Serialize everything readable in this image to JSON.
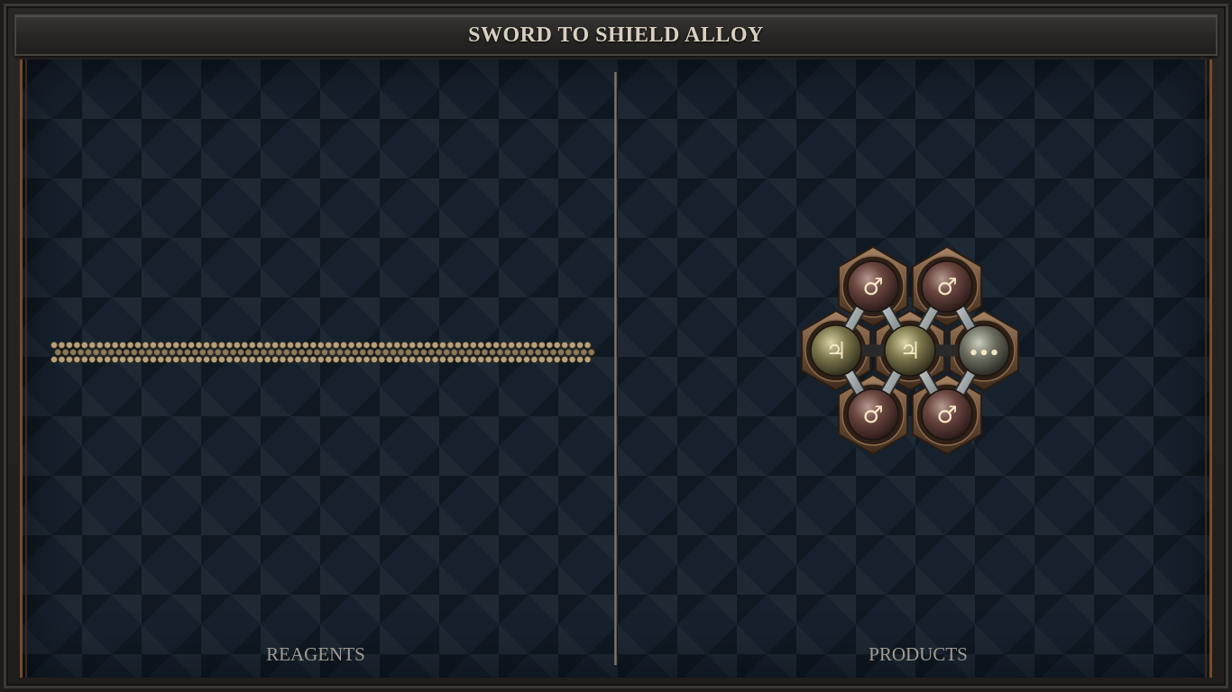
{
  "title": "SWORD TO SHIELD ALLOY",
  "panels": {
    "reagents_label": "REAGENTS",
    "products_label": "PRODUCTS"
  },
  "colors": {
    "board": "#16212d",
    "frame": "#2a2826",
    "title_text": "#d9cfc0",
    "label_text": "#a29b92",
    "copper_trim": "#7a4a2a",
    "atom_iron": "#5d3a36",
    "atom_tin": "#6c6843",
    "atom_salt": "#575a4d",
    "glyph": "#f3e6c4"
  },
  "reagent": {
    "description_icon": "long-atom-chain",
    "rows": 3,
    "atoms_per_row": 71
  },
  "product_molecule": {
    "atoms": [
      {
        "id": "a1",
        "element": "iron",
        "symbol": "♂"
      },
      {
        "id": "a2",
        "element": "iron",
        "symbol": "♂"
      },
      {
        "id": "a3",
        "element": "tin",
        "symbol": "♃"
      },
      {
        "id": "a4",
        "element": "tin",
        "symbol": "♃"
      },
      {
        "id": "a5",
        "element": "salt",
        "symbol": "•••"
      },
      {
        "id": "a6",
        "element": "iron",
        "symbol": "♂"
      },
      {
        "id": "a7",
        "element": "iron",
        "symbol": "♂"
      }
    ],
    "bonds": [
      [
        "a1",
        "a3"
      ],
      [
        "a1",
        "a4"
      ],
      [
        "a2",
        "a4"
      ],
      [
        "a2",
        "a5"
      ],
      [
        "a3",
        "a4"
      ],
      [
        "a4",
        "a5"
      ],
      [
        "a3",
        "a6"
      ],
      [
        "a4",
        "a6"
      ],
      [
        "a4",
        "a7"
      ],
      [
        "a5",
        "a7"
      ]
    ]
  }
}
